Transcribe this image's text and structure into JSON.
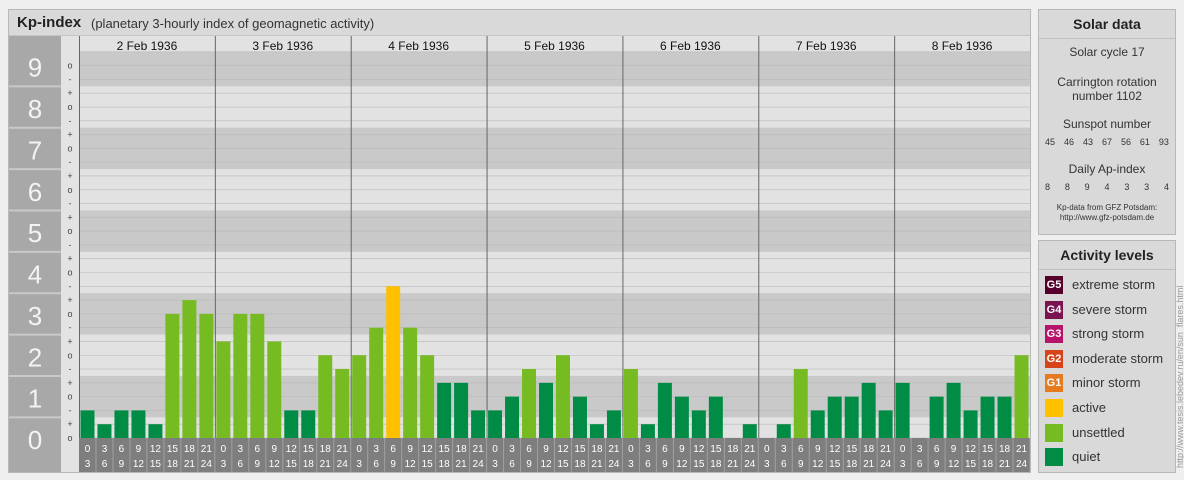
{
  "header": {
    "title": "Kp-index",
    "subtitle": "(planetary 3-hourly index of geomagnetic activity)"
  },
  "chart_data": {
    "type": "bar",
    "title": "Kp-index",
    "subtitle": "(planetary 3-hourly index of geomagnetic activity)",
    "ylim": [
      0,
      9
    ],
    "y_ticks": [
      "0",
      "1",
      "2",
      "3",
      "4",
      "5",
      "6",
      "7",
      "8",
      "9"
    ],
    "y_minor_marks": [
      "o",
      "+",
      "-",
      "o",
      "+",
      "-",
      "o",
      "+",
      "-",
      "o",
      "+",
      "-",
      "o",
      "+",
      "-",
      "o",
      "+",
      "-",
      "o",
      "+",
      "-",
      "o",
      "+",
      "-",
      "o",
      "+",
      "-",
      "o"
    ],
    "days": [
      "2 Feb 1936",
      "3 Feb 1936",
      "4 Feb 1936",
      "5 Feb 1936",
      "6 Feb 1936",
      "7 Feb 1936",
      "8 Feb 1936"
    ],
    "interval_start_labels": [
      "0",
      "3",
      "6",
      "9",
      "12",
      "15",
      "18",
      "21"
    ],
    "interval_end_labels": [
      "3",
      "6",
      "9",
      "12",
      "15",
      "18",
      "21",
      "24"
    ],
    "values": [
      0.667,
      0.333,
      0.667,
      0.667,
      0.333,
      3.0,
      3.333,
      3.0,
      2.333,
      3.0,
      3.0,
      2.333,
      0.667,
      0.667,
      2.0,
      1.667,
      2.0,
      2.667,
      3.667,
      2.667,
      2.0,
      1.333,
      1.333,
      0.667,
      0.667,
      1.0,
      1.667,
      1.333,
      2.0,
      1.0,
      0.333,
      0.667,
      1.667,
      0.333,
      1.333,
      1.0,
      0.667,
      1.0,
      0.0,
      0.333,
      0.0,
      0.333,
      1.667,
      0.667,
      1.0,
      1.0,
      1.333,
      0.667,
      1.333,
      0.0,
      1.0,
      1.333,
      0.667,
      1.0,
      1.0,
      2.0
    ],
    "categories": [
      "quiet",
      "quiet",
      "quiet",
      "quiet",
      "quiet",
      "unsettled",
      "unsettled",
      "unsettled",
      "unsettled",
      "unsettled",
      "unsettled",
      "unsettled",
      "quiet",
      "quiet",
      "unsettled",
      "unsettled",
      "unsettled",
      "unsettled",
      "active",
      "unsettled",
      "unsettled",
      "quiet",
      "quiet",
      "quiet",
      "quiet",
      "quiet",
      "unsettled",
      "quiet",
      "unsettled",
      "quiet",
      "quiet",
      "quiet",
      "unsettled",
      "quiet",
      "quiet",
      "quiet",
      "quiet",
      "quiet",
      "quiet",
      "quiet",
      "quiet",
      "quiet",
      "unsettled",
      "quiet",
      "quiet",
      "quiet",
      "quiet",
      "quiet",
      "quiet",
      "quiet",
      "quiet",
      "quiet",
      "quiet",
      "quiet",
      "quiet",
      "unsettled"
    ],
    "colors": {
      "quiet": "#008c44",
      "unsettled": "#77bb22",
      "active": "#ffc000"
    },
    "grid": true
  },
  "solar": {
    "title": "Solar data",
    "cycle": "Solar cycle 17",
    "carrington": "Carrington rotation number 1102",
    "sunspot_title": "Sunspot number",
    "sunspots": [
      "45",
      "46",
      "43",
      "67",
      "56",
      "61",
      "93"
    ],
    "ap_title": "Daily Ap-index",
    "ap": [
      "8",
      "8",
      "9",
      "4",
      "3",
      "3",
      "4"
    ],
    "credit_line1": "Kp-data from GFZ Potsdam:",
    "credit_line2": "http://www.gfz-potsdam.de"
  },
  "levels": {
    "title": "Activity levels",
    "items": [
      {
        "code": "G5",
        "label": "extreme storm",
        "color": "#55002a"
      },
      {
        "code": "G4",
        "label": "severe storm",
        "color": "#7a1350"
      },
      {
        "code": "G3",
        "label": "strong storm",
        "color": "#b8136a"
      },
      {
        "code": "G2",
        "label": "moderate storm",
        "color": "#d8441a"
      },
      {
        "code": "G1",
        "label": "minor storm",
        "color": "#e67a1e"
      },
      {
        "code": "",
        "label": "active",
        "color": "#ffc000"
      },
      {
        "code": "",
        "label": "unsettled",
        "color": "#77bb22"
      },
      {
        "code": "",
        "label": "quiet",
        "color": "#008c44"
      }
    ]
  },
  "watermark": "http://www.tesis.lebedev.ru/en/sun_flares.html"
}
